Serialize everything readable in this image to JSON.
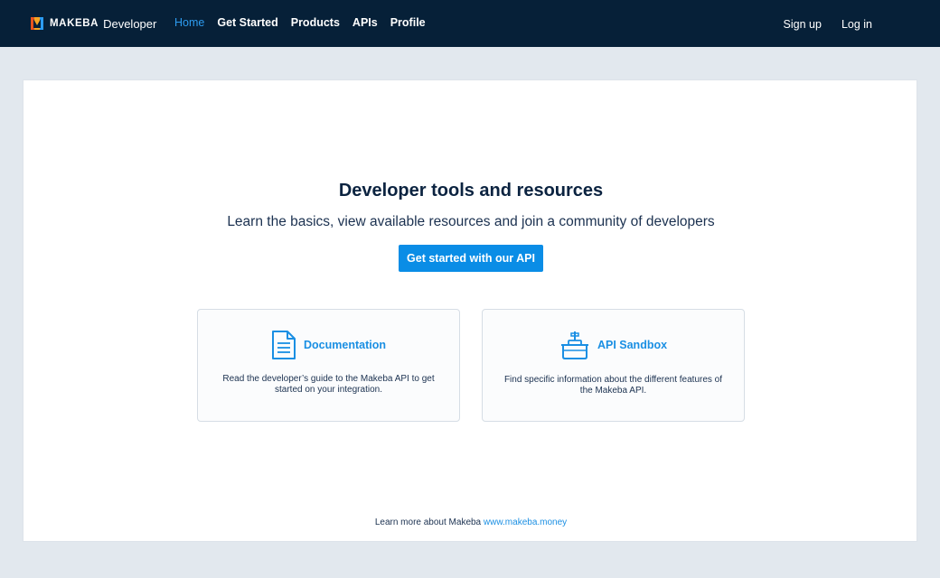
{
  "header": {
    "brand_name": "MAKEBA",
    "brand_sub": "Developer",
    "nav": [
      "Home",
      "Get Started",
      "Products",
      "APIs",
      "Profile"
    ],
    "active_nav": "Home",
    "signup_label": "Sign up",
    "login_label": "Log in"
  },
  "hero": {
    "title": "Developer tools and resources",
    "subtitle": "Learn the basics, view available resources and join a community of developers",
    "cta_label": "Get started with our API"
  },
  "features": [
    {
      "title": "Documentation",
      "icon": "document-icon",
      "description": "Read the developer’s guide to the Makeba API to get started on your integration."
    },
    {
      "title": "API Sandbox",
      "icon": "sandbox-icon",
      "description": "Find specific information about the different features of the Makeba API."
    }
  ],
  "footer": {
    "text": "Learn more about Makeba",
    "link_text": "www.makeba.money"
  },
  "colors": {
    "topbar": "#062038",
    "accent": "#0a8de6",
    "link": "#1a8fe3",
    "page_bg": "#e2e8ee",
    "text": "#0b2340"
  }
}
